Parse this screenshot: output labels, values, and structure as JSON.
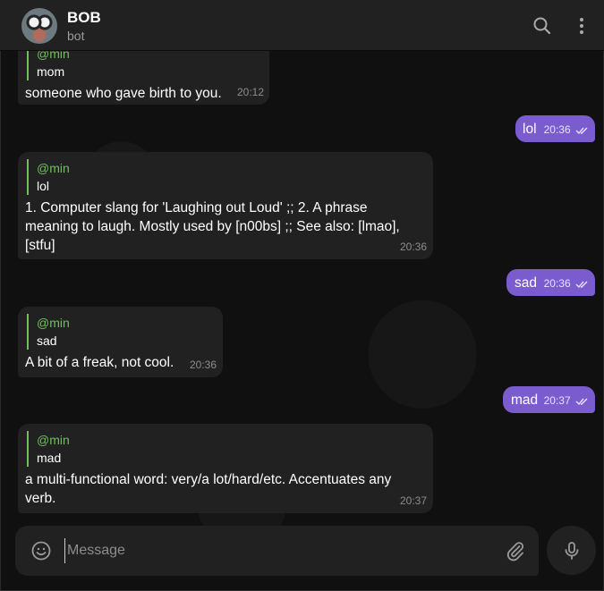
{
  "header": {
    "title": "BOB",
    "subtitle": "bot"
  },
  "messages": [
    {
      "dir": "in",
      "quote_author": "@min",
      "quote_text": "mom",
      "text": "someone who gave birth to you.",
      "time": "20:12"
    },
    {
      "dir": "out",
      "text": "lol",
      "time": "20:36"
    },
    {
      "dir": "in",
      "quote_author": "@min",
      "quote_text": "lol",
      "text": "1. Computer slang for 'Laughing out Loud' ;; 2. A phrase meaning to laugh. Mostly used by [n00bs] ;; See also: [lmao], [stfu]",
      "time": "20:36"
    },
    {
      "dir": "out",
      "text": "sad",
      "time": "20:36"
    },
    {
      "dir": "in",
      "quote_author": "@min",
      "quote_text": "sad",
      "text": "A bit of a freak, not cool.",
      "time": "20:36"
    },
    {
      "dir": "out",
      "text": "mad",
      "time": "20:37"
    },
    {
      "dir": "in",
      "quote_author": "@min",
      "quote_text": "mad",
      "text": "a multi-functional word: very/a lot/hard/etc. Accentuates any verb.",
      "time": "20:37"
    }
  ],
  "composer": {
    "placeholder": "Message"
  },
  "colors": {
    "outgoing_bubble": "#7a5ccf",
    "incoming_bubble": "#212121",
    "quote_accent": "#6ec05a"
  },
  "icons": [
    "search-icon",
    "more-vertical-icon",
    "emoji-icon",
    "paperclip-icon",
    "microphone-icon",
    "double-check-icon"
  ]
}
